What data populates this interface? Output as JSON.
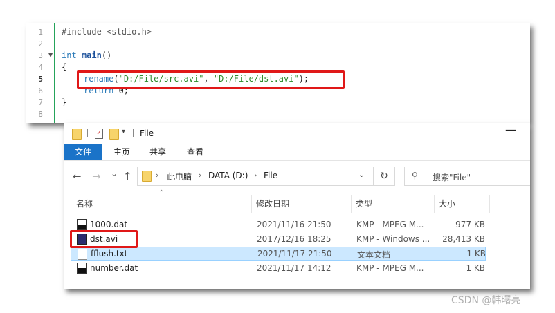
{
  "editor": {
    "line_numbers": [
      "1",
      "2",
      "3",
      "4",
      "5",
      "6",
      "7",
      "8"
    ],
    "lines": {
      "l1": "#include <stdio.h>",
      "l3_kw": "int",
      "l3_fn": "main",
      "l3_rest": "()",
      "l4": "{",
      "l5_fn": "rename",
      "l5_open": "(",
      "l5_arg1": "\"D:/File/src.avi\"",
      "l5_comma": ", ",
      "l5_arg2": "\"D:/File/dst.avi\"",
      "l5_close": ");",
      "l6_kw": "return",
      "l6_rest": " 0;",
      "l7": "}"
    },
    "fold_marker": "▼"
  },
  "explorer": {
    "title": "File",
    "ribbon_tabs": [
      "文件",
      "主页",
      "共享",
      "查看"
    ],
    "nav": {
      "back": "←",
      "forward": "→",
      "recent": "⌄",
      "up": "↑"
    },
    "address": [
      "此电脑",
      "DATA (D:)",
      "File"
    ],
    "address_sep": "›",
    "refresh": "↻",
    "search_placeholder": "搜索\"File\"",
    "columns": [
      "名称",
      "修改日期",
      "类型",
      "大小"
    ],
    "files": [
      {
        "name": "1000.dat",
        "date": "2021/11/16 21:50",
        "type": "KMP - MPEG M...",
        "size": "977 KB"
      },
      {
        "name": "dst.avi",
        "date": "2017/12/16 18:25",
        "type": "KMP - Windows ...",
        "size": "28,413 KB"
      },
      {
        "name": "fflush.txt",
        "date": "2021/11/17 21:50",
        "type": "文本文档",
        "size": "1 KB"
      },
      {
        "name": "number.dat",
        "date": "2021/11/17 14:12",
        "type": "KMP - MPEG M...",
        "size": "1 KB"
      }
    ]
  },
  "watermark": "CSDN @韩曙亮",
  "colors": {
    "highlight_box": "#e01818",
    "selection": "#cce8ff",
    "ribbon_file_tab": "#1a73c8",
    "fold_bar": "#25a35a"
  }
}
